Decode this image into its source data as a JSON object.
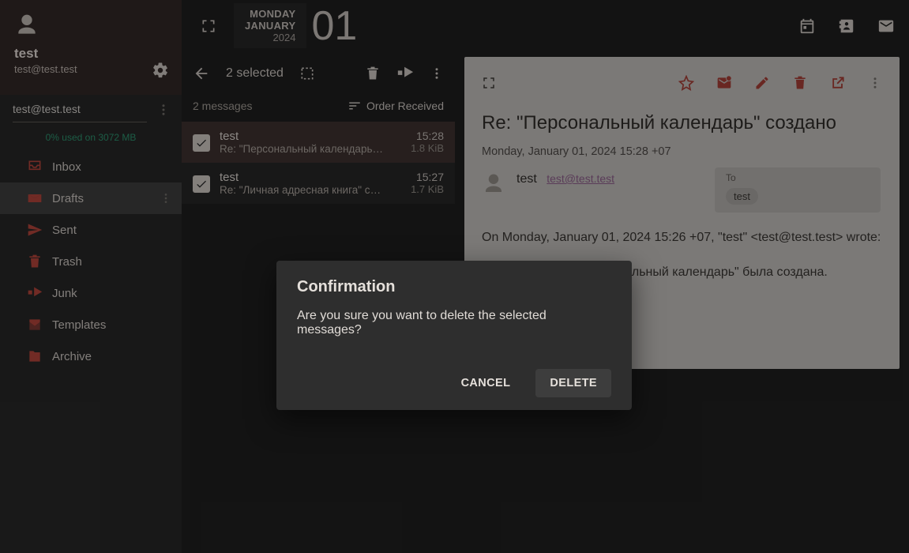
{
  "profile": {
    "username": "test",
    "email": "test@test.test"
  },
  "account": {
    "name": "test@test.test",
    "quota": "0% used on 3072 MB"
  },
  "folders": [
    {
      "name": "Inbox",
      "icon": "inbox"
    },
    {
      "name": "Drafts",
      "icon": "drafts",
      "selected": true
    },
    {
      "name": "Sent",
      "icon": "send"
    },
    {
      "name": "Trash",
      "icon": "trash"
    },
    {
      "name": "Junk",
      "icon": "junk"
    },
    {
      "name": "Templates",
      "icon": "templates"
    },
    {
      "name": "Archive",
      "icon": "archive"
    }
  ],
  "date": {
    "dow": "MONDAY",
    "month": "JANUARY",
    "year": "2024",
    "day": "01"
  },
  "selection": {
    "count_text": "2 selected"
  },
  "listHeader": {
    "count": "2 messages",
    "sort": "Order Received"
  },
  "messages": [
    {
      "sender": "test",
      "subject": "Re: \"Персональный календарь\" со…",
      "time": "15:28",
      "size": "1.8 KiB"
    },
    {
      "sender": "test",
      "subject": "Re: \"Личная адресная книга\" созда…",
      "time": "15:27",
      "size": "1.7 KiB"
    }
  ],
  "reader": {
    "subject": "Re: \"Персональный календарь\" создано",
    "date": "Monday, January 01, 2024 15:28 +07",
    "from_name": "test",
    "from_addr": "test@test.test",
    "to_label": "To",
    "to_chip": "test",
    "body_line1": "On Monday, January 01, 2024 15:26 +07, \"test\" <test@test.test> wrote:",
    "body_line2": "Ваш календарь \"Персональный календарь\" была создана."
  },
  "modal": {
    "title": "Confirmation",
    "text": "Are you sure you want to delete the selected messages?",
    "cancel": "CANCEL",
    "delete": "DELETE"
  }
}
